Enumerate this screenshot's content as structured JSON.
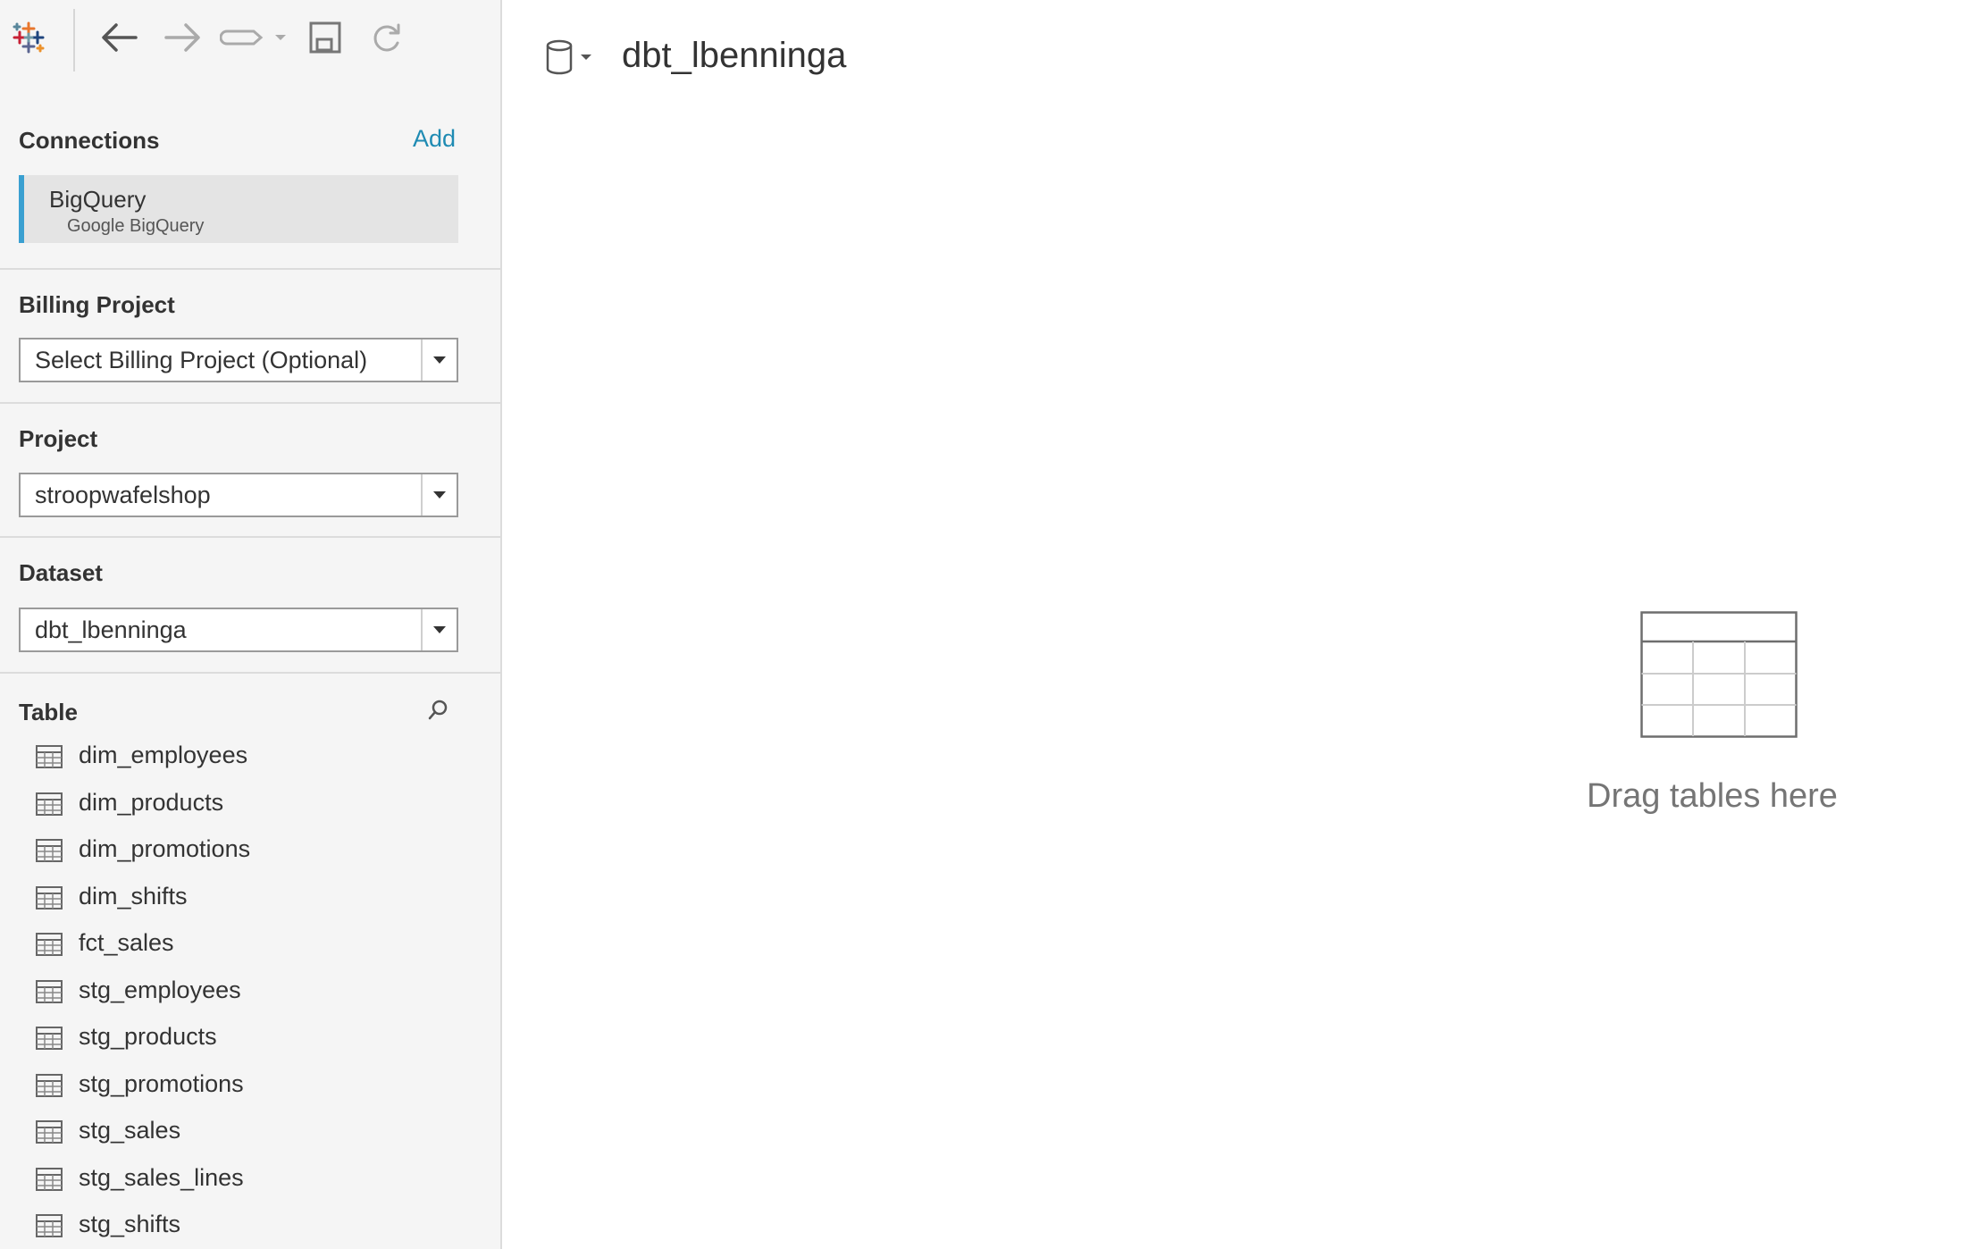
{
  "toolbar": {
    "icons": [
      "tableau-logo-icon",
      "back-arrow-icon",
      "forward-arrow-icon",
      "redirect-icon",
      "chevron-down-icon",
      "save-icon",
      "refresh-icon"
    ]
  },
  "connections": {
    "title": "Connections",
    "add_label": "Add",
    "items": [
      {
        "name": "BigQuery",
        "type": "Google BigQuery"
      }
    ],
    "accent": "#3aa0d1"
  },
  "billing_project": {
    "title": "Billing Project",
    "value": "Select Billing Project (Optional)"
  },
  "project": {
    "title": "Project",
    "value": "stroopwafelshop"
  },
  "dataset": {
    "title": "Dataset",
    "value": "dbt_lbenninga"
  },
  "tables": {
    "title": "Table",
    "items": [
      "dim_employees",
      "dim_products",
      "dim_promotions",
      "dim_shifts",
      "fct_sales",
      "stg_employees",
      "stg_products",
      "stg_promotions",
      "stg_sales",
      "stg_sales_lines",
      "stg_shifts"
    ]
  },
  "canvas": {
    "title": "dbt_lbenninga",
    "drop_hint": "Drag tables here"
  },
  "colors": {
    "link": "#1f8bb3",
    "sidebar_bg": "#f5f5f5",
    "hint_text": "#757575"
  }
}
